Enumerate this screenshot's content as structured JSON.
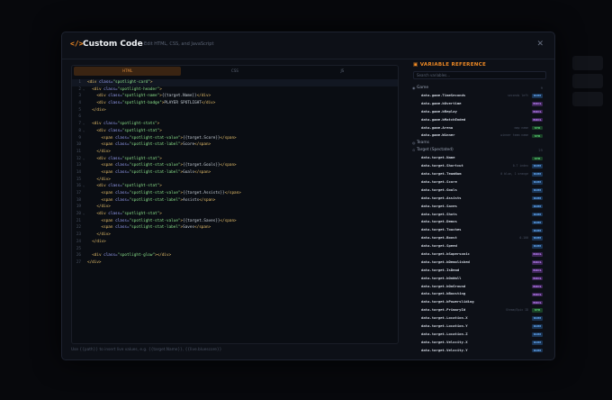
{
  "modal": {
    "icon": "</>",
    "title": "Custom Code",
    "subtitle": "Edit HTML, CSS, and JavaScript",
    "close": "✕"
  },
  "editor": {
    "tabs": [
      "HTML",
      "CSS",
      "JS"
    ],
    "lines": [
      {
        "n": "1",
        "fold": "",
        "cur": true,
        "segs": [
          [
            "tg",
            "<div "
          ],
          [
            "at",
            "class="
          ],
          [
            "st",
            "\"spotlight-card\""
          ],
          [
            "tg",
            ">"
          ]
        ]
      },
      {
        "n": "2",
        "fold": "⌄",
        "segs": [
          [
            "ct",
            "  "
          ],
          [
            "tg",
            "<div "
          ],
          [
            "at",
            "class="
          ],
          [
            "st",
            "\"spotlight-header\""
          ],
          [
            "tg",
            ">"
          ]
        ]
      },
      {
        "n": "3",
        "fold": "",
        "segs": [
          [
            "ct",
            "    "
          ],
          [
            "tg",
            "<div "
          ],
          [
            "at",
            "class="
          ],
          [
            "st",
            "\"spotlight-name\""
          ],
          [
            "tg",
            ">"
          ],
          [
            "ct",
            "{{target.Name}}"
          ],
          [
            "tg",
            "</div>"
          ]
        ]
      },
      {
        "n": "4",
        "fold": "",
        "segs": [
          [
            "ct",
            "    "
          ],
          [
            "tg",
            "<div "
          ],
          [
            "at",
            "class="
          ],
          [
            "st",
            "\"spotlight-badge\""
          ],
          [
            "tg",
            ">"
          ],
          [
            "ct",
            "PLAYER SPOTLIGHT"
          ],
          [
            "tg",
            "</div>"
          ]
        ]
      },
      {
        "n": "5",
        "fold": "",
        "segs": [
          [
            "ct",
            "  "
          ],
          [
            "tg",
            "</div>"
          ]
        ]
      },
      {
        "n": "6",
        "fold": "",
        "segs": [
          [
            "ct",
            ""
          ]
        ]
      },
      {
        "n": "7",
        "fold": "⌄",
        "segs": [
          [
            "ct",
            "  "
          ],
          [
            "tg",
            "<div "
          ],
          [
            "at",
            "class="
          ],
          [
            "st",
            "\"spotlight-stats\""
          ],
          [
            "tg",
            ">"
          ]
        ]
      },
      {
        "n": "8",
        "fold": "⌄",
        "segs": [
          [
            "ct",
            "    "
          ],
          [
            "tg",
            "<div "
          ],
          [
            "at",
            "class="
          ],
          [
            "st",
            "\"spotlight-stat\""
          ],
          [
            "tg",
            ">"
          ]
        ]
      },
      {
        "n": "9",
        "fold": "",
        "segs": [
          [
            "ct",
            "      "
          ],
          [
            "tg",
            "<span "
          ],
          [
            "at",
            "class="
          ],
          [
            "st",
            "\"spotlight-stat-value\""
          ],
          [
            "tg",
            ">"
          ],
          [
            "ct",
            "{{target.Score}}"
          ],
          [
            "tg",
            "</span>"
          ]
        ]
      },
      {
        "n": "10",
        "fold": "",
        "segs": [
          [
            "ct",
            "      "
          ],
          [
            "tg",
            "<span "
          ],
          [
            "at",
            "class="
          ],
          [
            "st",
            "\"spotlight-stat-label\""
          ],
          [
            "tg",
            ">"
          ],
          [
            "ct",
            "Score"
          ],
          [
            "tg",
            "</span>"
          ]
        ]
      },
      {
        "n": "11",
        "fold": "",
        "segs": [
          [
            "ct",
            "    "
          ],
          [
            "tg",
            "</div>"
          ]
        ]
      },
      {
        "n": "12",
        "fold": "⌄",
        "segs": [
          [
            "ct",
            "    "
          ],
          [
            "tg",
            "<div "
          ],
          [
            "at",
            "class="
          ],
          [
            "st",
            "\"spotlight-stat\""
          ],
          [
            "tg",
            ">"
          ]
        ]
      },
      {
        "n": "13",
        "fold": "",
        "segs": [
          [
            "ct",
            "      "
          ],
          [
            "tg",
            "<span "
          ],
          [
            "at",
            "class="
          ],
          [
            "st",
            "\"spotlight-stat-value\""
          ],
          [
            "tg",
            ">"
          ],
          [
            "ct",
            "{{target.Goals}}"
          ],
          [
            "tg",
            "</span>"
          ]
        ]
      },
      {
        "n": "14",
        "fold": "",
        "segs": [
          [
            "ct",
            "      "
          ],
          [
            "tg",
            "<span "
          ],
          [
            "at",
            "class="
          ],
          [
            "st",
            "\"spotlight-stat-label\""
          ],
          [
            "tg",
            ">"
          ],
          [
            "ct",
            "Goals"
          ],
          [
            "tg",
            "</span>"
          ]
        ]
      },
      {
        "n": "15",
        "fold": "",
        "segs": [
          [
            "ct",
            "    "
          ],
          [
            "tg",
            "</div>"
          ]
        ]
      },
      {
        "n": "16",
        "fold": "⌄",
        "segs": [
          [
            "ct",
            "    "
          ],
          [
            "tg",
            "<div "
          ],
          [
            "at",
            "class="
          ],
          [
            "st",
            "\"spotlight-stat\""
          ],
          [
            "tg",
            ">"
          ]
        ]
      },
      {
        "n": "17",
        "fold": "",
        "segs": [
          [
            "ct",
            "      "
          ],
          [
            "tg",
            "<span "
          ],
          [
            "at",
            "class="
          ],
          [
            "st",
            "\"spotlight-stat-value\""
          ],
          [
            "tg",
            ">"
          ],
          [
            "ct",
            "{{target.Assists}}"
          ],
          [
            "tg",
            "</span>"
          ]
        ]
      },
      {
        "n": "18",
        "fold": "",
        "segs": [
          [
            "ct",
            "      "
          ],
          [
            "tg",
            "<span "
          ],
          [
            "at",
            "class="
          ],
          [
            "st",
            "\"spotlight-stat-label\""
          ],
          [
            "tg",
            ">"
          ],
          [
            "ct",
            "Assists"
          ],
          [
            "tg",
            "</span>"
          ]
        ]
      },
      {
        "n": "19",
        "fold": "",
        "segs": [
          [
            "ct",
            "    "
          ],
          [
            "tg",
            "</div>"
          ]
        ]
      },
      {
        "n": "20",
        "fold": "⌄",
        "segs": [
          [
            "ct",
            "    "
          ],
          [
            "tg",
            "<div "
          ],
          [
            "at",
            "class="
          ],
          [
            "st",
            "\"spotlight-stat\""
          ],
          [
            "tg",
            ">"
          ]
        ]
      },
      {
        "n": "21",
        "fold": "",
        "segs": [
          [
            "ct",
            "      "
          ],
          [
            "tg",
            "<span "
          ],
          [
            "at",
            "class="
          ],
          [
            "st",
            "\"spotlight-stat-value\""
          ],
          [
            "tg",
            ">"
          ],
          [
            "ct",
            "{{target.Saves}}"
          ],
          [
            "tg",
            "</span>"
          ]
        ]
      },
      {
        "n": "22",
        "fold": "",
        "segs": [
          [
            "ct",
            "      "
          ],
          [
            "tg",
            "<span "
          ],
          [
            "at",
            "class="
          ],
          [
            "st",
            "\"spotlight-stat-label\""
          ],
          [
            "tg",
            ">"
          ],
          [
            "ct",
            "Saves"
          ],
          [
            "tg",
            "</span>"
          ]
        ]
      },
      {
        "n": "23",
        "fold": "",
        "segs": [
          [
            "ct",
            "    "
          ],
          [
            "tg",
            "</div>"
          ]
        ]
      },
      {
        "n": "24",
        "fold": "",
        "segs": [
          [
            "ct",
            "  "
          ],
          [
            "tg",
            "</div>"
          ]
        ]
      },
      {
        "n": "25",
        "fold": "",
        "segs": [
          [
            "ct",
            ""
          ]
        ]
      },
      {
        "n": "26",
        "fold": "",
        "segs": [
          [
            "ct",
            "  "
          ],
          [
            "tg",
            "<div "
          ],
          [
            "at",
            "class="
          ],
          [
            "st",
            "\"spotlight-glow\""
          ],
          [
            "tg",
            "></div>"
          ]
        ]
      },
      {
        "n": "27",
        "fold": "",
        "segs": [
          [
            "tg",
            "</div>"
          ]
        ]
      }
    ],
    "footnote": "Use {{path}} to insert live values, e.g. {{target.Name}}, {{live.bluescore}}"
  },
  "variables": {
    "title": "VARIABLE REFERENCE",
    "search_placeholder": "Search variables...",
    "groups": [
      {
        "icon": "game-icon",
        "glyph": "◉",
        "name": "Game",
        "count": "9",
        "items": [
          {
            "path": "data.game.TimeSeconds",
            "example": "seconds left",
            "type": "NUM"
          },
          {
            "path": "data.game.bOvertime",
            "example": "",
            "type": "BOOL"
          },
          {
            "path": "data.game.bReplay",
            "example": "",
            "type": "BOOL"
          },
          {
            "path": "data.game.bMatchEnded",
            "example": "",
            "type": "BOOL"
          },
          {
            "path": "data.game.Arena",
            "example": "map name",
            "type": "STR"
          },
          {
            "path": "data.game.Winner",
            "example": "winner team name",
            "type": "STR"
          }
        ]
      },
      {
        "icon": "teams-icon",
        "glyph": "◍",
        "name": "Teams",
        "count": "",
        "items": []
      },
      {
        "icon": "target-icon",
        "glyph": "⊙",
        "name": "Target (Spectated)",
        "count": "25",
        "items": [
          {
            "path": "data.target.Name",
            "example": "",
            "type": "STR"
          },
          {
            "path": "data.target.Shortcut",
            "example": "0-7 index",
            "type": "NUM"
          },
          {
            "path": "data.target.TeamNum",
            "example": "0 blue, 1 orange",
            "type": "NUM"
          },
          {
            "path": "data.target.Score",
            "example": "",
            "type": "NUM"
          },
          {
            "path": "data.target.Goals",
            "example": "",
            "type": "NUM"
          },
          {
            "path": "data.target.Assists",
            "example": "",
            "type": "NUM"
          },
          {
            "path": "data.target.Saves",
            "example": "",
            "type": "NUM"
          },
          {
            "path": "data.target.Shots",
            "example": "",
            "type": "NUM"
          },
          {
            "path": "data.target.Demos",
            "example": "",
            "type": "NUM"
          },
          {
            "path": "data.target.Touches",
            "example": "",
            "type": "NUM"
          },
          {
            "path": "data.target.Boost",
            "example": "0-100",
            "type": "NUM"
          },
          {
            "path": "data.target.Speed",
            "example": "",
            "type": "NUM"
          },
          {
            "path": "data.target.bSupersonic",
            "example": "",
            "type": "BOOL"
          },
          {
            "path": "data.target.bDemolished",
            "example": "",
            "type": "BOOL"
          },
          {
            "path": "data.target.IsDead",
            "example": "",
            "type": "BOOL"
          },
          {
            "path": "data.target.bOnWall",
            "example": "",
            "type": "BOOL"
          },
          {
            "path": "data.target.bOnGround",
            "example": "",
            "type": "BOOL"
          },
          {
            "path": "data.target.bBoosting",
            "example": "",
            "type": "BOOL"
          },
          {
            "path": "data.target.bPowersliding",
            "example": "",
            "type": "BOOL"
          },
          {
            "path": "data.target.PrimaryId",
            "example": "Steam/Epic ID",
            "type": "STR"
          },
          {
            "path": "data.target.Location.X",
            "example": "",
            "type": "NUM"
          },
          {
            "path": "data.target.Location.Y",
            "example": "",
            "type": "NUM"
          },
          {
            "path": "data.target.Location.Z",
            "example": "",
            "type": "NUM"
          },
          {
            "path": "data.target.Velocity.X",
            "example": "",
            "type": "NUM"
          },
          {
            "path": "data.target.Velocity.Y",
            "example": "",
            "type": "NUM"
          }
        ]
      }
    ]
  }
}
